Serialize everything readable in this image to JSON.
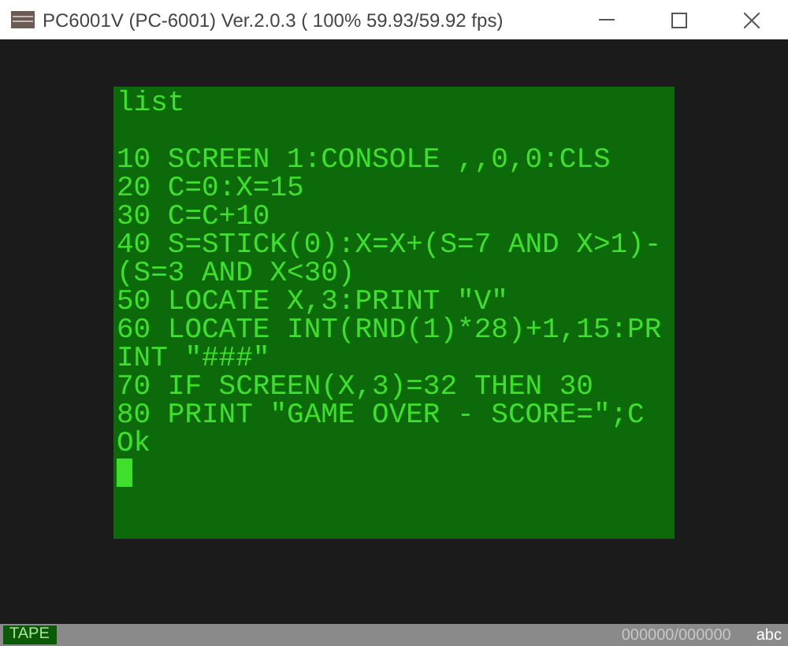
{
  "window": {
    "title": "PC6001V (PC-6001) Ver.2.0.3 ( 100%  59.93/59.92 fps)"
  },
  "screen": {
    "command": "list",
    "listing": [
      "10 SCREEN 1:CONSOLE ,,0,0:CLS",
      "20 C=0:X=15",
      "30 C=C+10",
      "40 S=STICK(0):X=X+(S=7 AND X>1)-",
      "(S=3 AND X<30)",
      "50 LOCATE X,3:PRINT \"V\"",
      "60 LOCATE INT(RND(1)*28)+1,15:PR",
      "INT \"###\"",
      "70 IF SCREEN(X,3)=32 THEN 30",
      "80 PRINT \"GAME OVER - SCORE=\";C"
    ],
    "prompt": "Ok"
  },
  "status_bar": {
    "tape": "TAPE",
    "counter": "000000/000000",
    "input_mode": "abc"
  }
}
